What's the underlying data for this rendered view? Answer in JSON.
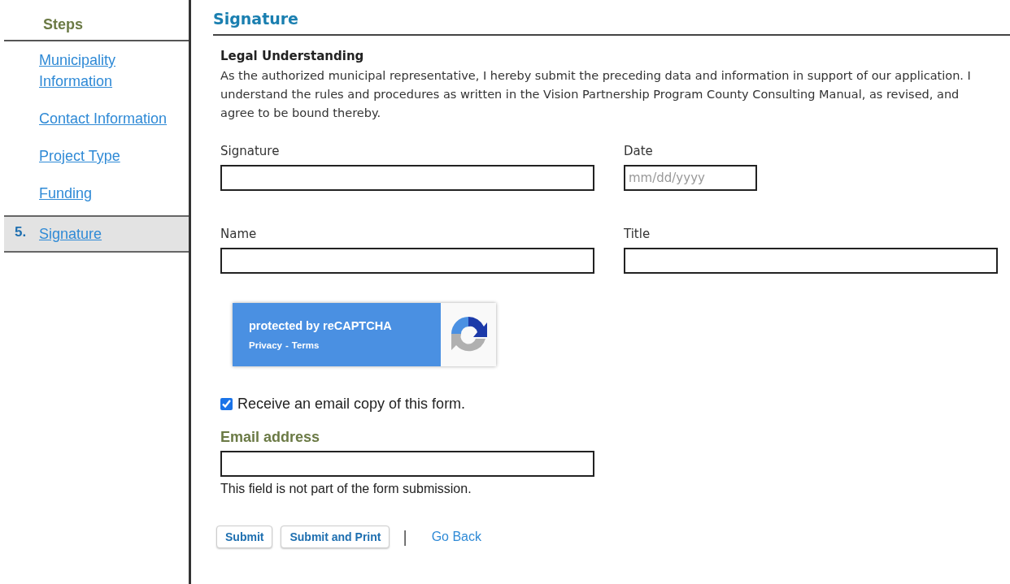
{
  "sidebar": {
    "heading": "Steps",
    "items": [
      {
        "label": "Municipality Information",
        "selected": false
      },
      {
        "label": "Contact Information",
        "selected": false
      },
      {
        "label": "Project Type",
        "selected": false
      },
      {
        "label": "Funding",
        "selected": false
      },
      {
        "number": "5.",
        "label": "Signature",
        "selected": true
      }
    ]
  },
  "page_title": "Signature",
  "legal": {
    "heading": "Legal Understanding",
    "text": "As the authorized municipal representative, I hereby submit the preceding data and information in support of our application. I understand the rules and procedures as written in the Vision Partnership Program County Consulting Manual, as revised, and agree to be bound thereby."
  },
  "fields": [
    {
      "label": "Signature",
      "kind": "wide"
    },
    {
      "label": "Date",
      "kind": "date",
      "placeholder": "mm/dd/yyyy"
    },
    {
      "label": "Name",
      "kind": "wide"
    },
    {
      "label": "Title",
      "kind": "wide"
    }
  ],
  "recaptcha": {
    "text": "protected by reCAPTCHA",
    "privacy": "Privacy",
    "separator": "-",
    "terms": "Terms"
  },
  "email_copy": {
    "label": "Receive an email copy of this form.",
    "checked": true
  },
  "email": {
    "label": "Email address",
    "note": "This field is not part of the form submission."
  },
  "buttons": [
    "Submit",
    "Submit and Print"
  ],
  "separator": "|",
  "back_link": "Go Back"
}
